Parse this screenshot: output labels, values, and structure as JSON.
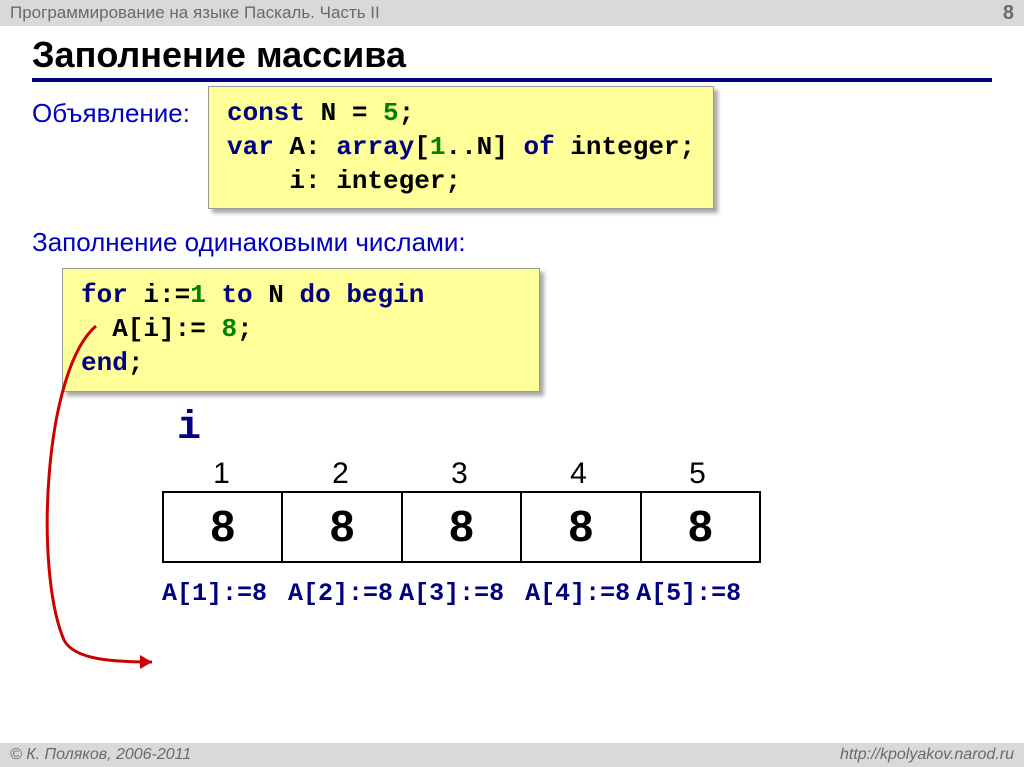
{
  "header": {
    "breadcrumb": "Программирование на языке Паскаль. Часть II",
    "page_number": "8"
  },
  "title": "Заполнение массива",
  "declaration": {
    "label": "Объявление:",
    "code": {
      "line1_kw1": "const",
      "line1_rest": " N = ",
      "line1_num": "5",
      "line1_end": ";",
      "line2_kw1": "var",
      "line2_mid": " A: ",
      "line2_kw2": "array",
      "line2_bracket1": "[",
      "line2_num": "1",
      "line2_rest": "..N] ",
      "line2_kw3": "of",
      "line2_type": " integer;",
      "line3": "    i: integer;"
    }
  },
  "fill_section": {
    "label": "Заполнение одинаковыми числами:",
    "code": {
      "line1_kw1": "for",
      "line1_mid": " i:=",
      "line1_num": "1",
      "line1_mid2": " ",
      "line1_kw2": "to",
      "line1_mid3": " N ",
      "line1_kw3": "do",
      "line1_mid4": " ",
      "line1_kw4": "begin",
      "line2": "  A[i]:= ",
      "line2_num": "8",
      "line2_end": ";",
      "line3_kw": "end",
      "line3_end": ";"
    }
  },
  "loop_var": "i",
  "array": {
    "indices": [
      "1",
      "2",
      "3",
      "4",
      "5"
    ],
    "values": [
      "8",
      "8",
      "8",
      "8",
      "8"
    ]
  },
  "assignments": [
    "A[1]:=8",
    "A[2]:=8",
    "A[3]:=8",
    "A[4]:=8",
    "A[5]:=8"
  ],
  "footer": {
    "copyright": "© К. Поляков, 2006-2011",
    "url": "http://kpolyakov.narod.ru"
  }
}
